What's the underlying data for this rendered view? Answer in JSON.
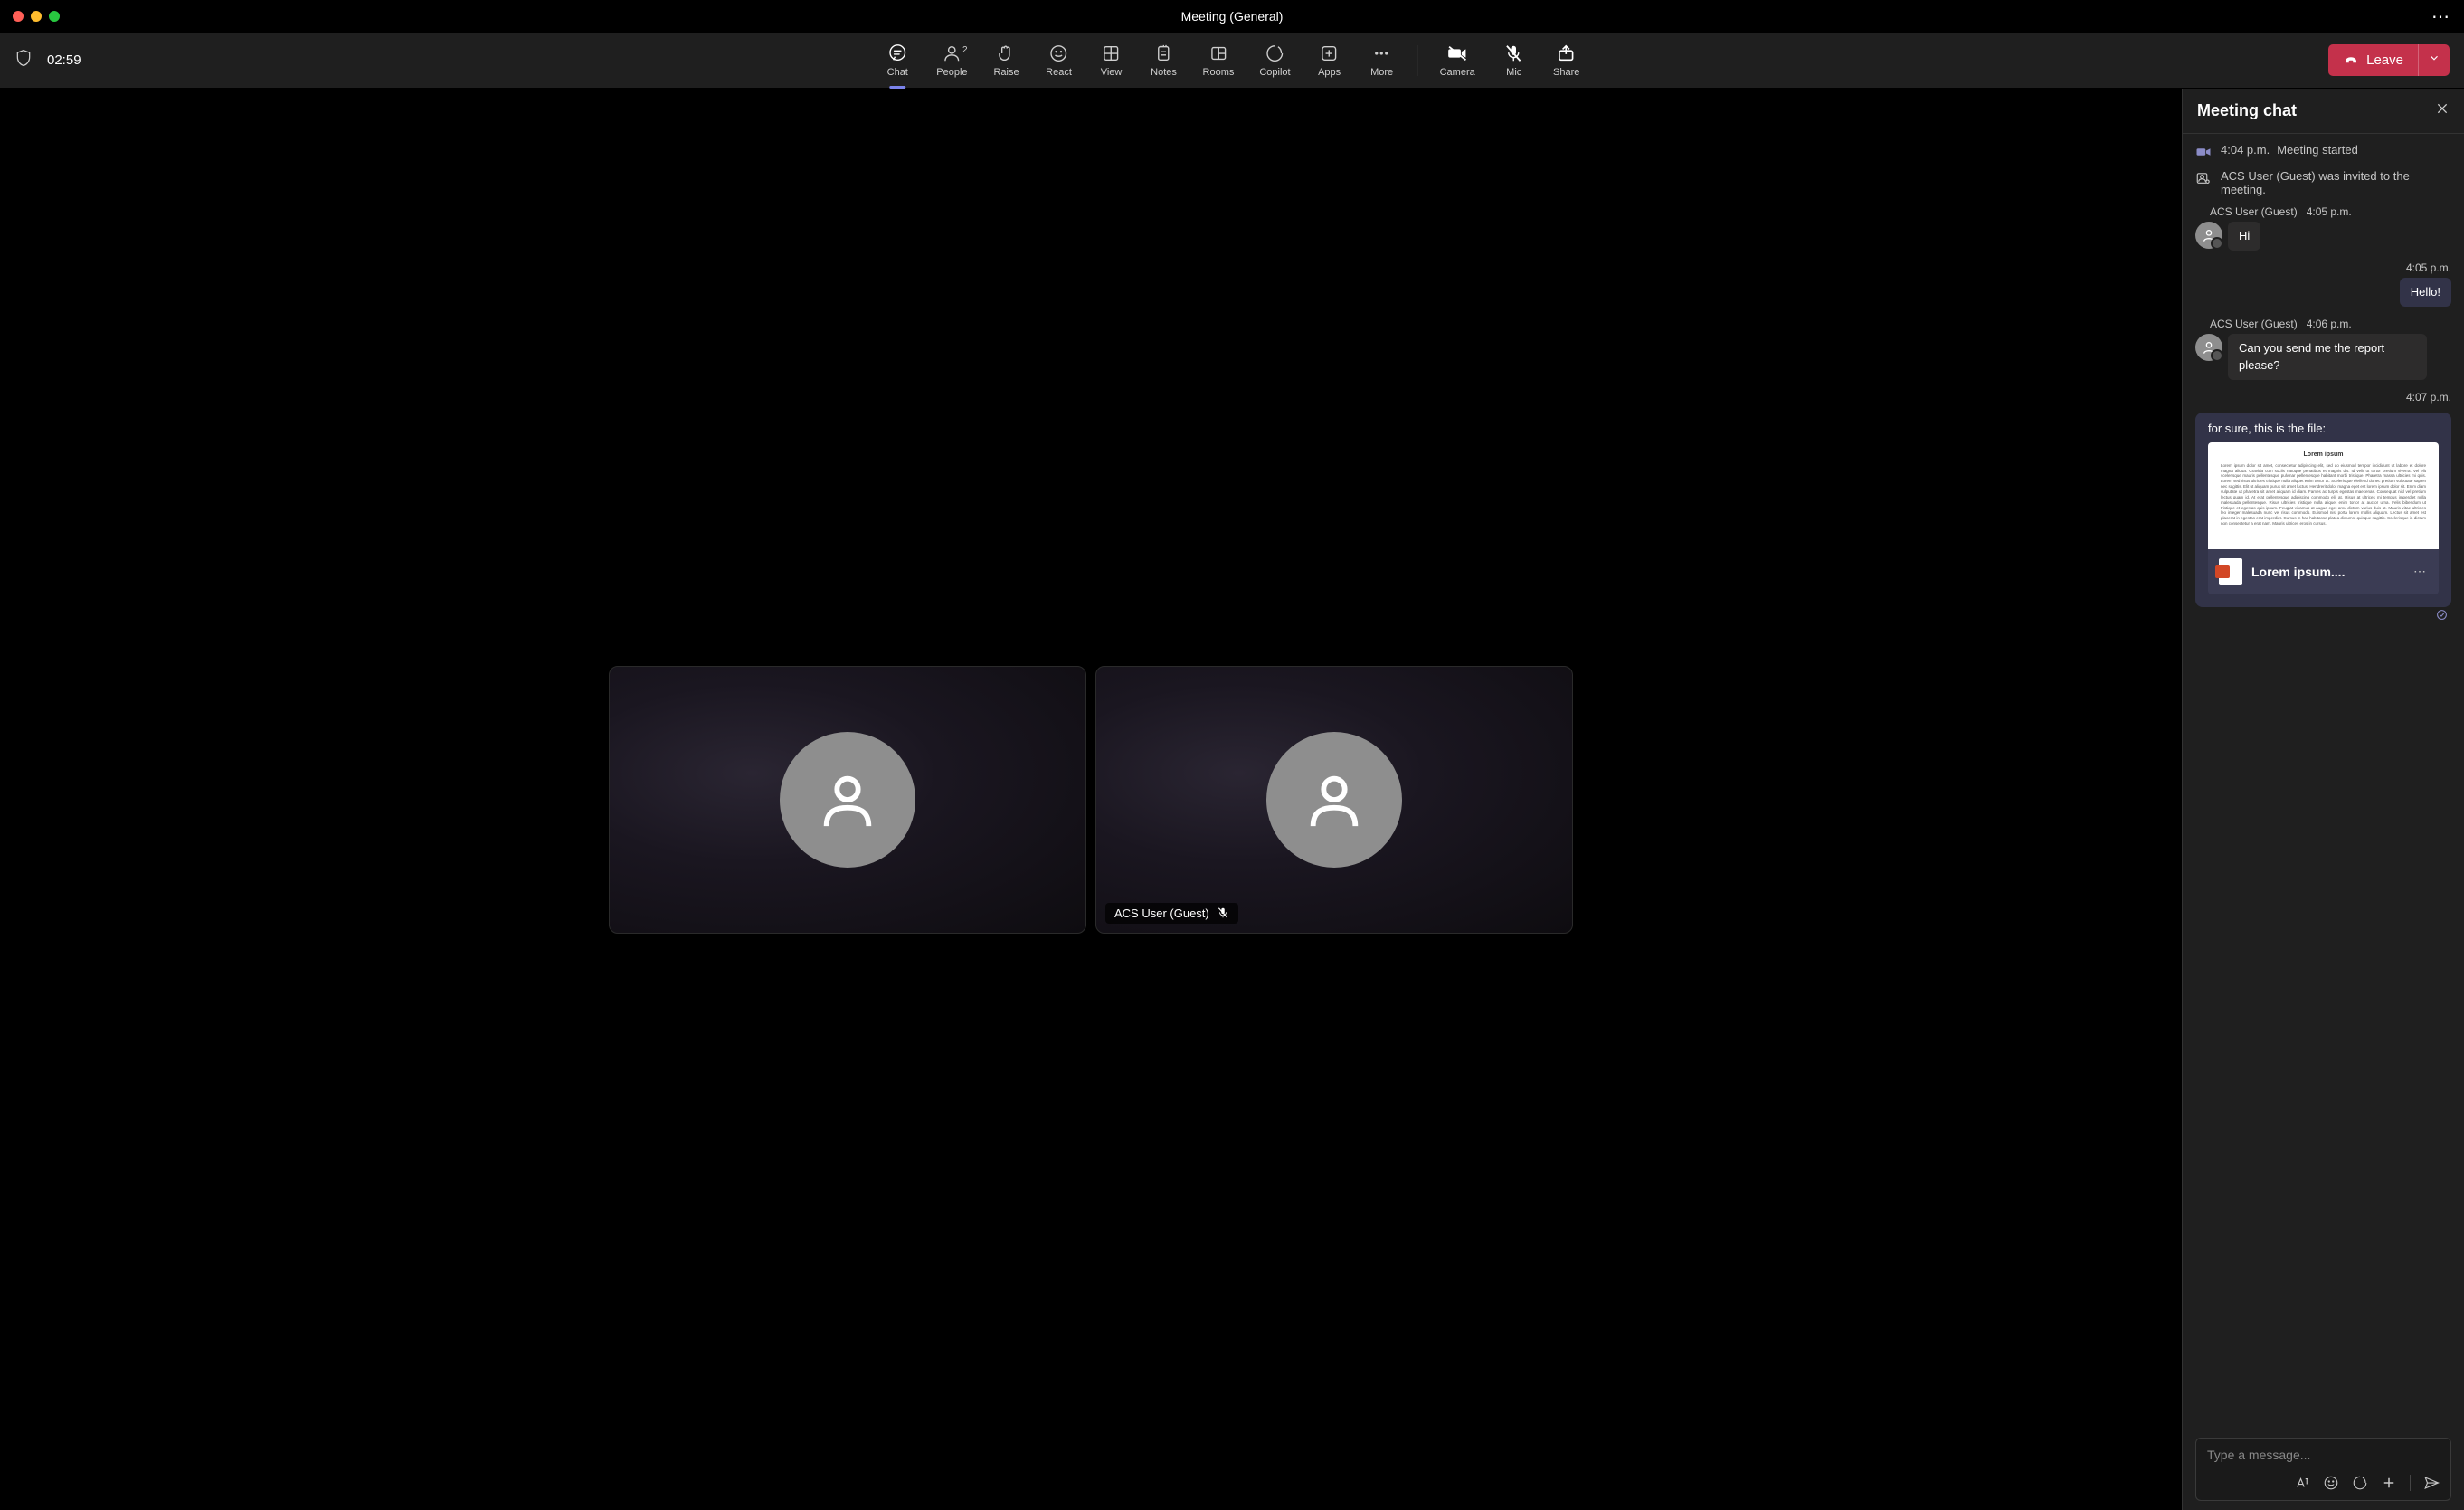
{
  "title": "Meeting (General)",
  "timer": "02:59",
  "toolbar": {
    "chat": "Chat",
    "people": "People",
    "people_count": "2",
    "raise": "Raise",
    "react": "React",
    "view": "View",
    "notes": "Notes",
    "rooms": "Rooms",
    "copilot": "Copilot",
    "apps": "Apps",
    "more": "More",
    "camera": "Camera",
    "mic": "Mic",
    "share": "Share",
    "leave": "Leave"
  },
  "tiles": {
    "tile2_label": "ACS User (Guest)"
  },
  "chat": {
    "title": "Meeting chat",
    "sys1_time": "4:04 p.m.",
    "sys1_text": "Meeting started",
    "sys2_text": "ACS User (Guest) was invited to the meeting.",
    "m1_sender": "ACS User (Guest)",
    "m1_time": "4:05 p.m.",
    "m1_text": "Hi",
    "m2_time": "4:05 p.m.",
    "m2_text": "Hello!",
    "m3_sender": "ACS User (Guest)",
    "m3_time": "4:06 p.m.",
    "m3_text": "Can you send me the report please?",
    "m4_time": "4:07 p.m.",
    "m4_text": "for sure, this is the file:",
    "file_preview_title": "Lorem ipsum",
    "file_preview_body": "Lorem ipsum dolor sit amet, consectetur adipiscing elit, sed do eiusmod tempor incididunt ut labore et dolore magna aliqua. Gravida cum sociis natoque penatibus et magnis dis. Id velit ut tortor pretium viverra. Vel elit scelerisque mauris pellentesque pulvinar pellentesque habitant morbi tristique. Pharetra massa ultricies mi quis. Lorem sed risus ultricies tristique nulla aliquet enim tortor at. Scelerisque eleifend donec pretium vulputate sapien nec sagittis. Elit ut aliquam purus sit amet luctus. Hendrerit dolor magna eget est lorem ipsum dolor sit. Enim diam vulputate ut pharetra sit amet aliquam id diam. Fames ac turpis egestas maecenas. Consequat nisl vel pretium lectus quam id. At erat pellentesque adipiscing commodo elit at. Risus at ultrices mi tempus imperdiet nulla malesuada pellentesque. Risus ultricies tristique nulla aliquet enim tortor at auctor urna. Felis bibendum ut tristique et egestas quis ipsum. Feugiat vivamus at augue eget arcu dictum varius duis at. Mauris vitae ultricies leo integer malesuada nunc vel risus commodo. Euismod nisi porta lorem mollis aliquam. Lectus sit amet est placerat in egestas erat imperdiet. Cursus in hac habitasse platea dictumst quisque sagittis. Scelerisque in dictum non consectetur a erat nam. Mauris ultrices eros in cursus.",
    "file_name": "Lorem ipsum....",
    "compose_placeholder": "Type a message..."
  }
}
